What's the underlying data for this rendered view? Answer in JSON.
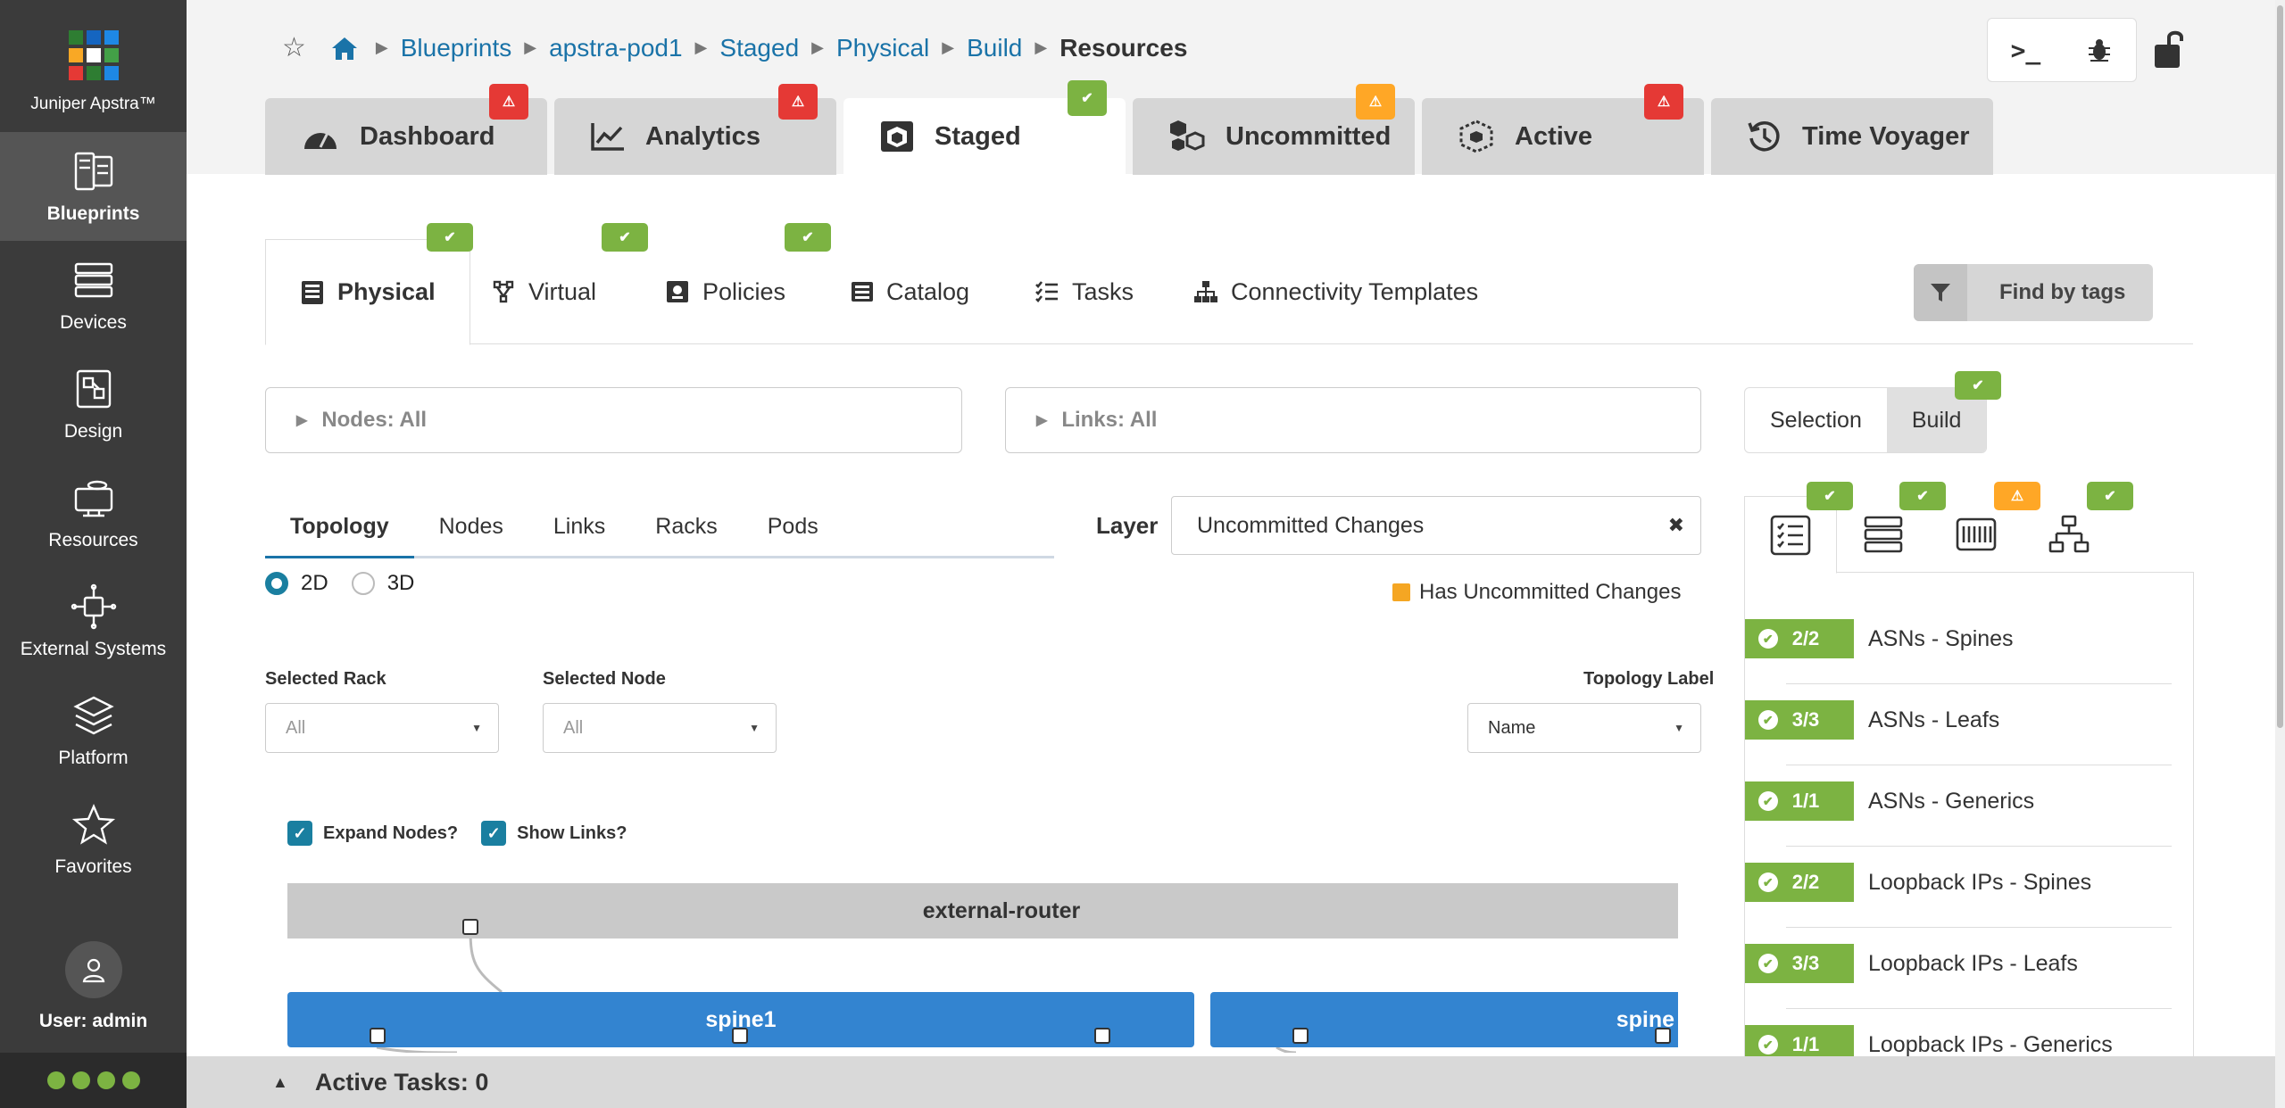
{
  "app": {
    "brand": "Juniper Apstra™",
    "logo_colors": [
      "#2e7d32",
      "#1565c0",
      "#1e88e5",
      "#f9a825",
      "#ffffff",
      "#43a047",
      "#e53935",
      "#2e7d32",
      "#1e88e5"
    ]
  },
  "sidebar": {
    "items": [
      {
        "label": "Blueprints",
        "icon": "blueprints-icon",
        "active": true
      },
      {
        "label": "Devices",
        "icon": "devices-icon"
      },
      {
        "label": "Design",
        "icon": "design-icon"
      },
      {
        "label": "Resources",
        "icon": "resources-icon"
      },
      {
        "label": "External Systems",
        "icon": "external-systems-icon"
      },
      {
        "label": "Platform",
        "icon": "platform-icon"
      },
      {
        "label": "Favorites",
        "icon": "star-icon"
      }
    ],
    "user": "User: admin"
  },
  "breadcrumb": {
    "items": [
      "Blueprints",
      "apstra-pod1",
      "Staged",
      "Physical",
      "Build"
    ],
    "current": "Resources"
  },
  "main_tabs": [
    {
      "label": "Dashboard",
      "icon": "gauge-icon",
      "badge": "error"
    },
    {
      "label": "Analytics",
      "icon": "chart-icon",
      "badge": "error"
    },
    {
      "label": "Staged",
      "icon": "cube-icon",
      "badge": "ok",
      "active": true
    },
    {
      "label": "Uncommitted",
      "icon": "cubes-icon",
      "badge": "warning"
    },
    {
      "label": "Active",
      "icon": "cube-dashed-icon",
      "badge": "error"
    },
    {
      "label": "Time Voyager",
      "icon": "history-icon"
    }
  ],
  "sub_tabs": [
    {
      "label": "Physical",
      "icon": "rack-icon",
      "active": true
    },
    {
      "label": "Virtual",
      "icon": "network-icon"
    },
    {
      "label": "Policies",
      "icon": "policy-icon"
    },
    {
      "label": "Catalog",
      "icon": "list-icon"
    },
    {
      "label": "Tasks",
      "icon": "tasks-icon"
    },
    {
      "label": "Connectivity Templates",
      "icon": "sitemap-icon"
    }
  ],
  "find_by_tags": "Find by tags",
  "filters": {
    "nodes": "Nodes: All",
    "links": "Links: All"
  },
  "mode": {
    "selection": "Selection",
    "build": "Build",
    "selected": "Build"
  },
  "view_tabs": [
    "Topology",
    "Nodes",
    "Links",
    "Racks",
    "Pods"
  ],
  "view_tab_selected": "Topology",
  "dimension": {
    "options": [
      "2D",
      "3D"
    ],
    "selected": "2D"
  },
  "layer": {
    "label": "Layer",
    "value": "Uncommitted Changes",
    "legend": "Has Uncommitted Changes",
    "legend_color": "#f5a623"
  },
  "selectors": {
    "rack": {
      "label": "Selected Rack",
      "value": "All"
    },
    "node": {
      "label": "Selected Node",
      "value": "All"
    },
    "topology_label": {
      "label": "Topology Label",
      "value": "Name"
    }
  },
  "options": {
    "expand_nodes": "Expand Nodes?",
    "show_links": "Show Links?"
  },
  "topology": {
    "external": "external-router",
    "spines": [
      "spine1",
      "spine"
    ]
  },
  "active_tasks": "Active Tasks: 0",
  "resources": [
    {
      "count": "2/2",
      "label": "ASNs - Spines"
    },
    {
      "count": "3/3",
      "label": "ASNs - Leafs"
    },
    {
      "count": "1/1",
      "label": "ASNs - Generics"
    },
    {
      "count": "2/2",
      "label": "Loopback IPs - Spines"
    },
    {
      "count": "3/3",
      "label": "Loopback IPs - Leafs"
    },
    {
      "count": "1/1",
      "label": "Loopback IPs - Generics"
    }
  ],
  "colors": {
    "ok": "#7cb342",
    "error": "#e53935",
    "warning": "#ffa726",
    "accent": "#1a73a8",
    "spine": "#3384d0"
  }
}
